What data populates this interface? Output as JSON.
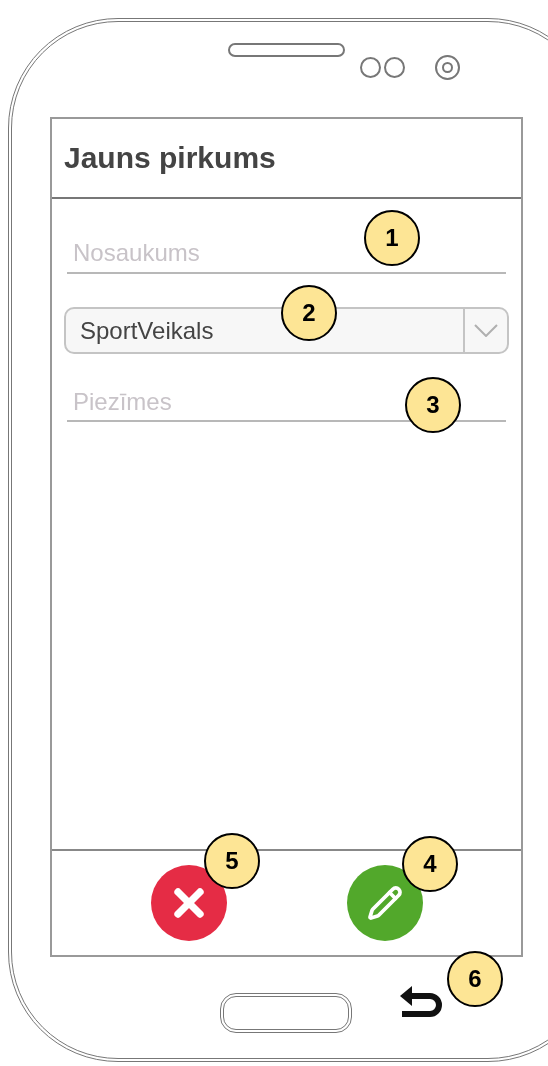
{
  "screen": {
    "title": "Jauns pirkums",
    "fields": [
      {
        "kind": "text",
        "placeholder": "Nosaukums",
        "marker": "1"
      },
      {
        "kind": "dropdown",
        "value": "SportVeikals",
        "marker": "2"
      },
      {
        "kind": "text",
        "placeholder": "Piezīmes",
        "marker": "3"
      }
    ],
    "actions": [
      {
        "kind": "cancel",
        "marker": "5"
      },
      {
        "kind": "edit",
        "marker": "4"
      }
    ]
  },
  "back_button": {
    "marker": "6"
  }
}
